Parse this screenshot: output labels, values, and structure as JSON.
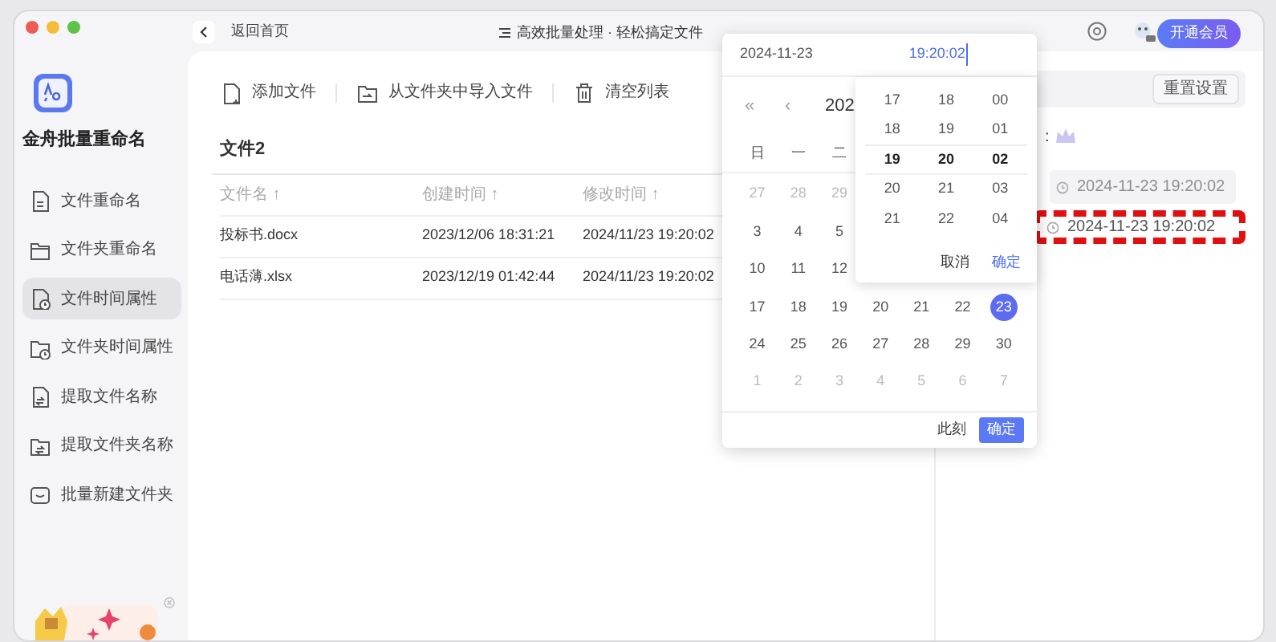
{
  "app": {
    "name": "金舟批量重命名"
  },
  "sidebar": {
    "items": [
      {
        "label": "文件重命名",
        "selected": false
      },
      {
        "label": "文件夹重命名",
        "selected": false
      },
      {
        "label": "文件时间属性",
        "selected": true
      },
      {
        "label": "文件夹时间属性",
        "selected": false
      },
      {
        "label": "提取文件名称",
        "selected": false
      },
      {
        "label": "提取文件夹名称",
        "selected": false
      },
      {
        "label": "批量新建文件夹",
        "selected": false
      }
    ]
  },
  "topbar": {
    "back": "返回首页",
    "title": "高效批量处理 · 轻松搞定文件",
    "vip_button": "开通会员"
  },
  "toolbar": [
    {
      "label": "添加文件"
    },
    {
      "label": "从文件夹中导入文件"
    },
    {
      "label": "清空列表"
    }
  ],
  "file_list": {
    "title": "文件2",
    "columns": [
      "文件名 ↑",
      "创建时间 ↑",
      "修改时间 ↑"
    ],
    "rows": [
      [
        "投标书.docx",
        "2023/12/06 18:31:21",
        "2024/11/23 19:20:02"
      ],
      [
        "电话薄.xlsx",
        "2023/12/19 01:42:44",
        "2024/11/23 19:20:02"
      ]
    ]
  },
  "settings": {
    "reset_button": "重置设置",
    "label": ":",
    "time_fields": [
      {
        "value": "2024-11-23 19:20:02",
        "disabled": true,
        "highlighted": false
      },
      {
        "value": "2024-11-23 19:20:02",
        "disabled": false,
        "highlighted": true
      }
    ]
  },
  "date_picker": {
    "date_input": "2024-11-23",
    "time_input": "19:20:02",
    "nav": [
      "«",
      "‹"
    ],
    "month_label": "202",
    "weekdays": [
      "日",
      "一",
      "二"
    ],
    "weeks": [
      [
        {
          "day": "27",
          "muted": true,
          "selected": false
        },
        {
          "day": "28",
          "muted": true,
          "selected": false
        },
        {
          "day": "29",
          "muted": true,
          "selected": false
        }
      ],
      [
        {
          "day": "3",
          "muted": false,
          "selected": false
        },
        {
          "day": "4",
          "muted": false,
          "selected": false
        },
        {
          "day": "5",
          "muted": false,
          "selected": false
        }
      ],
      [
        {
          "day": "10",
          "muted": false,
          "selected": false
        },
        {
          "day": "11",
          "muted": false,
          "selected": false
        },
        {
          "day": "12",
          "muted": false,
          "selected": false
        }
      ],
      [
        {
          "day": "17",
          "muted": false,
          "selected": false
        },
        {
          "day": "18",
          "muted": false,
          "selected": false
        },
        {
          "day": "19",
          "muted": false,
          "selected": false
        },
        {
          "day": "20",
          "muted": false,
          "selected": false
        },
        {
          "day": "21",
          "muted": false,
          "selected": false
        },
        {
          "day": "22",
          "muted": false,
          "selected": false
        },
        {
          "day": "23",
          "muted": false,
          "selected": true
        }
      ],
      [
        {
          "day": "24",
          "muted": false,
          "selected": false
        },
        {
          "day": "25",
          "muted": false,
          "selected": false
        },
        {
          "day": "26",
          "muted": false,
          "selected": false
        },
        {
          "day": "27",
          "muted": false,
          "selected": false
        },
        {
          "day": "28",
          "muted": false,
          "selected": false
        },
        {
          "day": "29",
          "muted": false,
          "selected": false
        },
        {
          "day": "30",
          "muted": false,
          "selected": false
        }
      ],
      [
        {
          "day": "1",
          "muted": true,
          "selected": false
        },
        {
          "day": "2",
          "muted": true,
          "selected": false
        },
        {
          "day": "3",
          "muted": true,
          "selected": false
        },
        {
          "day": "4",
          "muted": true,
          "selected": false
        },
        {
          "day": "5",
          "muted": true,
          "selected": false
        },
        {
          "day": "6",
          "muted": true,
          "selected": false
        },
        {
          "day": "7",
          "muted": true,
          "selected": false
        }
      ]
    ],
    "time_panel": {
      "columns": [
        [
          {
            "value": "17",
            "selected": false
          },
          {
            "value": "18",
            "selected": false
          },
          {
            "value": "19",
            "selected": true
          },
          {
            "value": "20",
            "selected": false
          },
          {
            "value": "21",
            "selected": false
          }
        ],
        [
          {
            "value": "18",
            "selected": false
          },
          {
            "value": "19",
            "selected": false
          },
          {
            "value": "20",
            "selected": true
          },
          {
            "value": "21",
            "selected": false
          },
          {
            "value": "22",
            "selected": false
          }
        ],
        [
          {
            "value": "00",
            "selected": false
          },
          {
            "value": "01",
            "selected": false
          },
          {
            "value": "02",
            "selected": true
          },
          {
            "value": "03",
            "selected": false
          },
          {
            "value": "04",
            "selected": false
          }
        ]
      ],
      "cancel": "取消",
      "ok": "确定"
    },
    "now_button": "此刻",
    "ok_button": "确定"
  }
}
